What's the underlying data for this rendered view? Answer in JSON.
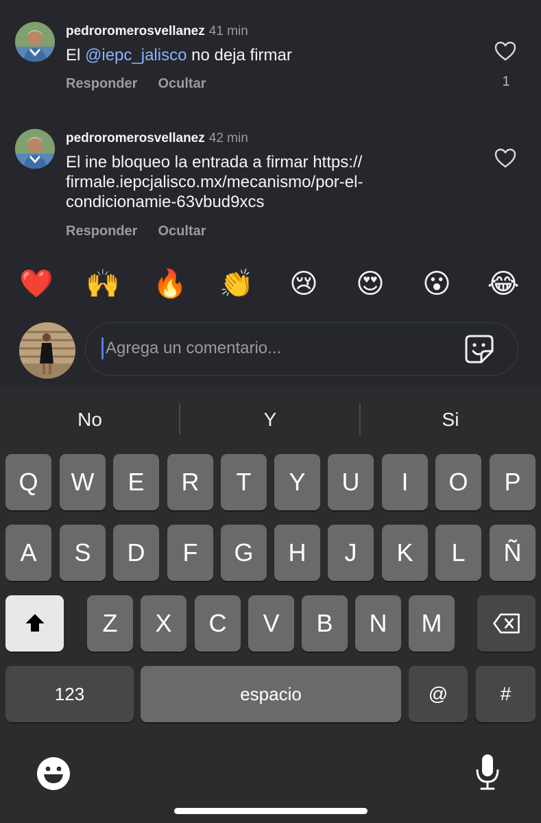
{
  "comments": [
    {
      "username": "pedroromerosvellanez",
      "time": "41 min",
      "text_before": "El ",
      "mention": "@iepc_jalisco",
      "text_after": " no deja firmar",
      "reply_label": "Responder",
      "hide_label": "Ocultar",
      "like_count": "1"
    },
    {
      "username": "pedroromerosvellanez",
      "time": "42 min",
      "text": "El ine bloqueo la entrada a firmar  https://firmale.iepcjalisco.mx/mecanismo/por-el-condicionamie-63vbud9xcs",
      "text_line1": "El ine bloqueo la entrada a firmar  https://",
      "text_line2": "firmale.iepcjalisco.mx/mecanismo/por-el-",
      "text_line3": "condicionamie-63vbud9xcs",
      "reply_label": "Responder",
      "hide_label": "Ocultar"
    }
  ],
  "emoji_reactions": [
    "❤️",
    "🙌",
    "🔥",
    "👏",
    "😢",
    "😍",
    "😮",
    "😂"
  ],
  "composer": {
    "placeholder": "Agrega un comentario..."
  },
  "keyboard": {
    "suggestions": [
      "No",
      "Y",
      "Si"
    ],
    "row1": [
      "Q",
      "W",
      "E",
      "R",
      "T",
      "Y",
      "U",
      "I",
      "O",
      "P"
    ],
    "row2": [
      "A",
      "S",
      "D",
      "F",
      "G",
      "H",
      "J",
      "K",
      "L",
      "Ñ"
    ],
    "row3": [
      "Z",
      "X",
      "C",
      "V",
      "B",
      "N",
      "M"
    ],
    "numbers_label": "123",
    "space_label": "espacio",
    "at_label": "@",
    "hash_label": "#"
  },
  "colors": {
    "background": "#25272c",
    "mention": "#8ab4ff",
    "caret": "#4d7cff",
    "keyboard_bg": "#2c2c2e"
  }
}
